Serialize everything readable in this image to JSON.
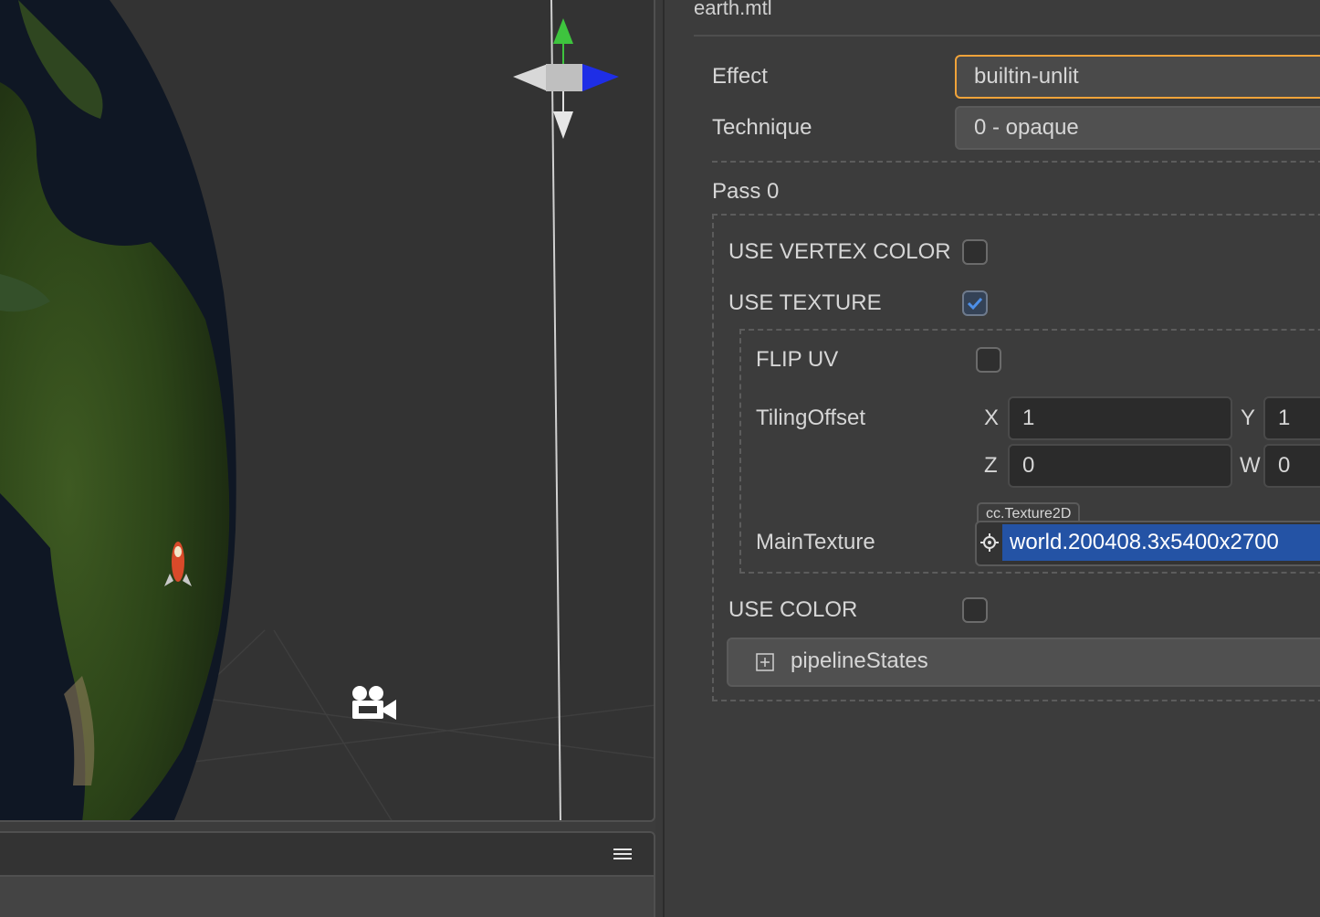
{
  "scene": {
    "toolbar_menu_icon": "hamburger-icon",
    "gizmo_icon": "transform-gizmo-icon",
    "camera_icon": "camera-icon",
    "rocket_icon": "rocket-icon"
  },
  "inspector": {
    "file_title": "earth.mtl",
    "effect": {
      "label": "Effect",
      "value": "builtin-unlit"
    },
    "technique": {
      "label": "Technique",
      "value": "0 - opaque"
    },
    "pass": {
      "title": "Pass 0",
      "use_vertex_color": {
        "label": "USE VERTEX COLOR",
        "checked": false
      },
      "use_texture": {
        "label": "USE TEXTURE",
        "checked": true
      },
      "texture_group": {
        "flip_uv": {
          "label": "FLIP UV",
          "checked": false
        },
        "tiling_offset": {
          "label": "TilingOffset",
          "x_label": "X",
          "x": "1",
          "y_label": "Y",
          "y": "1",
          "z_label": "Z",
          "z": "0",
          "w_label": "W",
          "w": "0"
        },
        "main_texture": {
          "label": "MainTexture",
          "type_badge": "cc.Texture2D",
          "value": "world.200408.3x5400x2700",
          "locate_icon": "target-icon"
        }
      },
      "use_color": {
        "label": "USE COLOR",
        "checked": false
      },
      "pipeline_states": {
        "label": "pipelineStates",
        "expand_icon": "plus-square-icon"
      }
    }
  },
  "colors": {
    "accent_focus": "#f0a33a",
    "selection": "#2453a5",
    "checkbox_check": "#4d8fe8",
    "gizmo_y": "#3ec43e",
    "gizmo_x": "#1e2ee6"
  }
}
